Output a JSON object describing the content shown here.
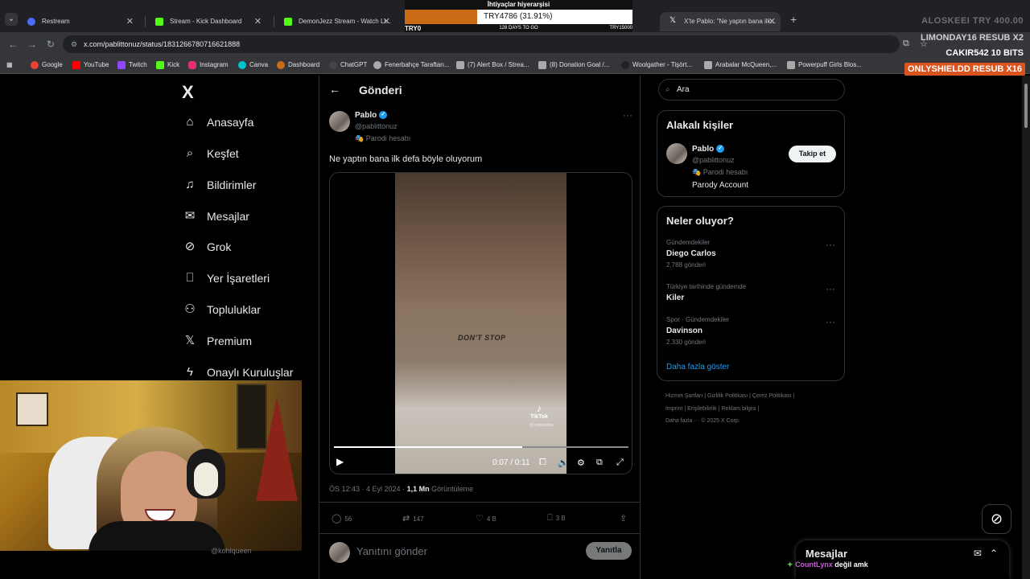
{
  "tabs": [
    {
      "title": "Restream",
      "favicon_color": "#4b6bff"
    },
    {
      "title": "Stream - Kick Dashboard",
      "favicon_color": "#53fc18"
    },
    {
      "title": "DemonJezz Stream - Watch Li...",
      "favicon_color": "#53fc18"
    },
    {
      "title": "X'te Pablo: \"Ne yaptın bana ilk...",
      "favicon_color": "#ffffff"
    }
  ],
  "address": {
    "url": "x.com/pablittonuz/status/1831266780716621888"
  },
  "bookmarks": [
    {
      "label": "Google",
      "color": "#ea4335"
    },
    {
      "label": "YouTube",
      "color": "#ff0000"
    },
    {
      "label": "Twitch",
      "color": "#9146ff"
    },
    {
      "label": "Kick",
      "color": "#53fc18"
    },
    {
      "label": "Instagram",
      "color": "#e1306c"
    },
    {
      "label": "Canva",
      "color": "#00c4cc"
    },
    {
      "label": "Dashboard",
      "color": "#cc6b16"
    },
    {
      "label": "ChatGPT",
      "color": "#444444"
    },
    {
      "label": "Fenerbahçe Taraftarı...",
      "color": "#aaaaaa"
    },
    {
      "label": "(7) Alert Box / Strea...",
      "color": "#aaaaaa"
    },
    {
      "label": "(8) Donation Goal /...",
      "color": "#aaaaaa"
    },
    {
      "label": "Woolgather - Tişört...",
      "color": "#222222"
    },
    {
      "label": "Arabalar McQueen,...",
      "color": "#aaaaaa"
    },
    {
      "label": "Powerpuff Girls Blos...",
      "color": "#aaaaaa"
    }
  ],
  "goal": {
    "title": "İhtiyaçlar hiyerarşisi",
    "progress_label": "TRY4786 (31.91%)",
    "progress_fraction": 0.3191,
    "min": "TRY0",
    "days": "128 DAYS TO GO",
    "max": "TRY15000"
  },
  "overlay": {
    "top_alert": "ALOSKEEI TRY 400.00",
    "sub_alert": "LIMONDAY16 RESUB X2",
    "bits_alert": "CAKIR542 10 BITS",
    "resub_banner": "ONLYSHIELDD RESUB X16"
  },
  "x": {
    "logo": "X",
    "nav": [
      {
        "label": "Anasayfa",
        "icon": "home-icon"
      },
      {
        "label": "Keşfet",
        "icon": "search-icon"
      },
      {
        "label": "Bildirimler",
        "icon": "bell-icon"
      },
      {
        "label": "Mesajlar",
        "icon": "mail-icon"
      },
      {
        "label": "Grok",
        "icon": "grok-icon"
      },
      {
        "label": "Yer İşaretleri",
        "icon": "bookmark-icon"
      },
      {
        "label": "Topluluklar",
        "icon": "communities-icon"
      },
      {
        "label": "Premium",
        "icon": "x-icon"
      },
      {
        "label": "Onaylı Kuruluşlar",
        "icon": "lightning-icon"
      }
    ],
    "post": {
      "header": "Gönderi",
      "author": "Pablo",
      "handle": "@pablittonuz",
      "parody": "Parodi hesabı",
      "text": "Ne yaptın bana ilk defa böyle oluyorum",
      "tattoo_text": "DON'T STOP",
      "watermark": "TikTok",
      "watermark_sub": "@ onkotattoo",
      "time_label": "0:07 / 0:11",
      "progress_fraction": 0.64,
      "timestamp": "ÖS 12:43 · 4 Eyl 2024 ·",
      "views": "1,1 Mn",
      "views_label": "Görüntüleme",
      "replies": "56",
      "reposts": "147",
      "likes": "4 B",
      "bookmarks": "3 B",
      "reply_placeholder": "Yanıtını gönder",
      "reply_button": "Yanıtla",
      "hidden_handle": "@kohlqueen"
    },
    "search_placeholder": "Ara",
    "related": {
      "title": "Alakalı kişiler",
      "name": "Pablo",
      "handle": "@pablittonuz",
      "parody": "Parodi hesabı",
      "bio": "Parody Account",
      "follow": "Takip et"
    },
    "trends": {
      "title": "Neler oluyor?",
      "items": [
        {
          "context": "Gündemdekiler",
          "name": "Diego Carlos",
          "count": "2.788 gönderi"
        },
        {
          "context": "Türkiye tarihinde gündemde",
          "name": "Kiler",
          "count": ""
        },
        {
          "context": "Spor · Gündemdekiler",
          "name": "Davinson",
          "count": "2.330 gönderi"
        }
      ],
      "show_more": "Daha fazla göster"
    },
    "footer": [
      "Hizmet Şartları  |  Gizlilik Politikası  |  Çerez Politikası  |",
      "Imprint  |  Erişilebilirlik  |  Reklam bilgisi  |",
      "Daha fazla ···   © 2025 X Corp."
    ],
    "messages": "Mesajlar"
  },
  "chat": {
    "user": "CountLynx",
    "message": "değil amk"
  }
}
